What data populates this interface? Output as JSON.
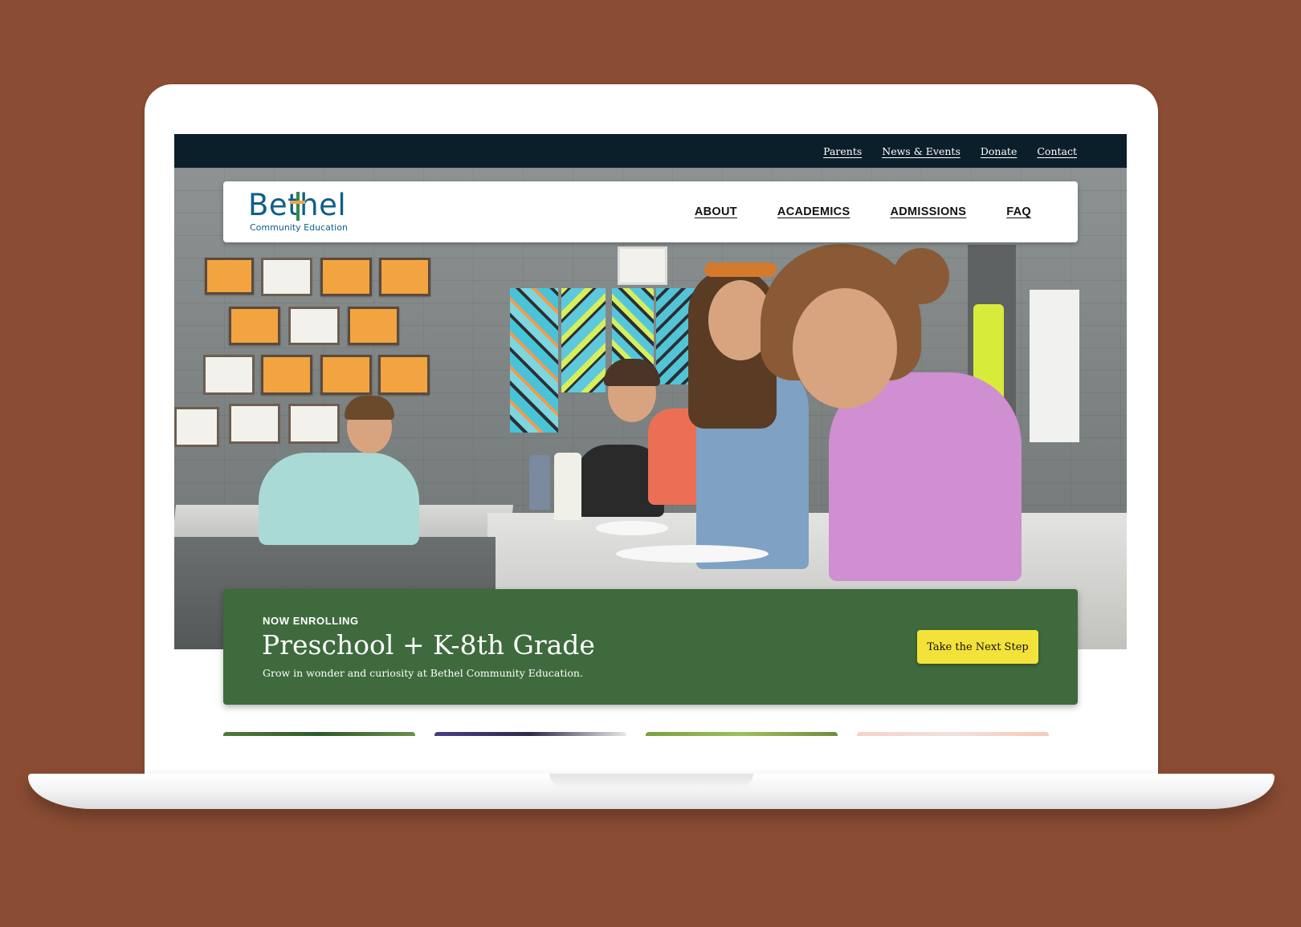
{
  "utility_nav": {
    "parents": "Parents",
    "news_events": "News & Events",
    "donate": "Donate",
    "contact": "Contact"
  },
  "logo": {
    "wordmark": "Bethel",
    "tagline": "Community Education"
  },
  "main_nav": {
    "about": "ABOUT",
    "academics": "ACADEMICS",
    "admissions": "ADMISSIONS",
    "faq": "FAQ"
  },
  "hero": {
    "photo_subject": "students-in-classroom"
  },
  "enroll": {
    "eyebrow": "NOW ENROLLING",
    "title": "Preschool + K-8th Grade",
    "subtitle": "Grow in wonder and curiosity at Bethel Community Education.",
    "cta_label": "Take the Next Step"
  },
  "colors": {
    "page_background": "#8a4c33",
    "utility_bar": "#0b1f2a",
    "brand_blue": "#0f5f88",
    "enroll_green": "#3e6a3d",
    "cta_yellow": "#f3e239"
  }
}
